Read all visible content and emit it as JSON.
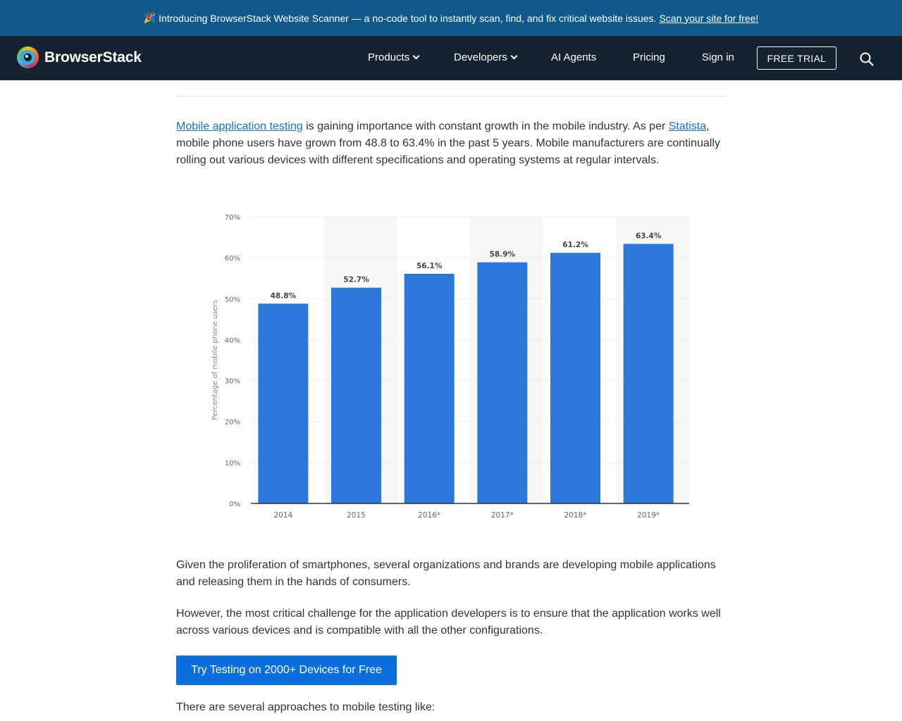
{
  "banner": {
    "emoji": "🎉",
    "text": "Introducing BrowserStack Website Scanner — a no-code tool to instantly scan, find, and fix critical website issues.",
    "link": "Scan your site for free!"
  },
  "nav": {
    "brand": "BrowserStack",
    "items": [
      {
        "label": "Products",
        "dropdown": true
      },
      {
        "label": "Developers",
        "dropdown": true
      },
      {
        "label": "AI Agents",
        "dropdown": false
      },
      {
        "label": "Pricing",
        "dropdown": false
      },
      {
        "label": "Sign in",
        "dropdown": false
      }
    ],
    "trial": "FREE TRIAL",
    "search_icon": "search-icon"
  },
  "article": {
    "intro": {
      "link1": "Mobile application testing",
      "text1": " is gaining importance with constant growth in the mobile industry. As per ",
      "link2": "Statista",
      "text2": ", mobile phone users have grown from 48.8 to 63.4% in the past 5 years. Mobile manufacturers are continually rolling out various devices with different specifications and operating systems at regular intervals."
    },
    "para2": "Given the proliferation of smartphones, several organizations and brands are developing mobile applications and releasing them in the hands of consumers.",
    "para3": "However, the most critical challenge for the application developers is to ensure that the application works well across various devices and is compatible with all the other configurations.",
    "cta": "Try Testing on 2000+ Devices for Free",
    "para4": "There are several approaches to mobile testing like:"
  },
  "chart_data": {
    "type": "bar",
    "categories": [
      "2014",
      "2015",
      "2016*",
      "2017*",
      "2018*",
      "2019*"
    ],
    "values": [
      48.8,
      52.7,
      56.1,
      58.9,
      61.2,
      63.4
    ],
    "value_labels": [
      "48.8%",
      "52.7%",
      "56.1%",
      "58.9%",
      "61.2%",
      "63.4%"
    ],
    "ylabel": "Percentage of mobile phone users",
    "ylim": [
      0,
      70
    ],
    "yticks": [
      "0%",
      "10%",
      "20%",
      "30%",
      "40%",
      "50%",
      "60%",
      "70%"
    ],
    "grid": true,
    "bar_color": "#2b77dc"
  }
}
